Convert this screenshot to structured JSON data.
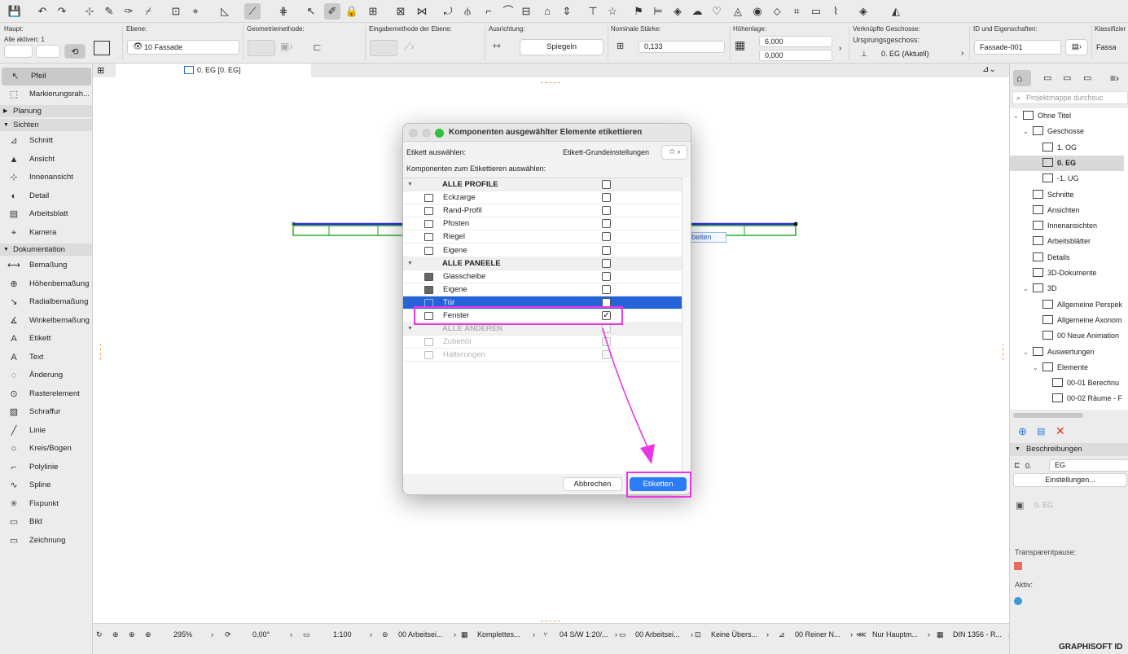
{
  "toolbar": {
    "icons": [
      "save-icon",
      "undo-icon",
      "redo-icon",
      "arrow-tool-icon",
      "magic-wand-icon",
      "eyedropper-icon",
      "syringe-icon",
      "select-icon",
      "guide-icon",
      "snap-icon",
      "trace-icon",
      "grid-icon",
      "pointer-icon",
      "pen-icon",
      "lock-icon",
      "group-icon",
      "suspend-icon",
      "mirror-icon",
      "rotate-icon",
      "split-icon",
      "offset-icon",
      "fillet-icon",
      "stretch-icon",
      "roof-icon",
      "elevate-icon",
      "dimension-icon",
      "star-icon",
      "flag-icon",
      "label-icon",
      "layer-icon",
      "cloud-icon",
      "favorite-icon",
      "tag-icon",
      "render-icon",
      "color-icon"
    ]
  },
  "infobox": {
    "haupt_label": "Haupt:",
    "alle_aktiven": "Alle aktiven: 1",
    "ebene_label": "Ebene:",
    "ebene_value": "10 Fassade",
    "geometrie_label": "Geometriemethode:",
    "eingabe_label": "Eingabemethode der Ebene:",
    "ausrichtung_label": "Ausrichtung:",
    "ausrichtung_value": "Spiegeln",
    "staerke_label": "Nominale Stärke:",
    "staerke_value": "0,133",
    "hoehe_label": "Höhenlage:",
    "hoehe_top": "6,000",
    "hoehe_bottom": "0,000",
    "geschosse_label": "Verknüpfte Geschosse:",
    "ursprung_label": "Ursprungsgeschoss:",
    "ursprung_value": "0. EG (Aktuell)",
    "id_label": "ID und Eigenschaften:",
    "id_value": "Fassade-001",
    "klass_label": "Klassifizier",
    "klass_value": "Fassa"
  },
  "toolbox": {
    "pfeil": "Pfeil",
    "markierung": "Markierungsrah...",
    "planung": "Planung",
    "sichten": "Sichten",
    "sichten_items": [
      "Schnitt",
      "Ansicht",
      "Innenansicht",
      "Detail",
      "Arbeitsblatt",
      "Kamera"
    ],
    "dokumentation": "Dokumentation",
    "doku_items": [
      "Bemaßung",
      "Höhenbemaßung",
      "Radialbemaßung",
      "Winkelbemaßung",
      "Etikett",
      "Text",
      "Änderung",
      "Rasterelement",
      "Schraffur",
      "Linie",
      "Kreis/Bogen",
      "Polylinie",
      "Spline",
      "Fixpunkt",
      "Bild",
      "Zeichnung"
    ]
  },
  "tab": {
    "label": "0. EG [0. EG]"
  },
  "canvas": {
    "tooltip_text": "beiten"
  },
  "dialog": {
    "title": "Komponenten ausgewählter Elemente etikettieren",
    "select_label": "Etikett auswählen:",
    "select_value": "Etikett-Grundeinstellungen",
    "components_label": "Komponenten zum Etikettieren auswählen:",
    "rows": [
      {
        "label": "ALLE PROFILE",
        "group": true,
        "checked": false,
        "disabled": false
      },
      {
        "label": "Eckzarge",
        "checked": false,
        "disabled": false
      },
      {
        "label": "Rand-Profil",
        "checked": false,
        "disabled": false
      },
      {
        "label": "Pfosten",
        "checked": false,
        "disabled": false
      },
      {
        "label": "Riegel",
        "checked": false,
        "disabled": false
      },
      {
        "label": "Eigene",
        "checked": false,
        "disabled": false
      },
      {
        "label": "ALLE PANEELE",
        "group": true,
        "checked": false,
        "disabled": false
      },
      {
        "label": "Glasscheibe",
        "checked": false,
        "disabled": false
      },
      {
        "label": "Eigene",
        "checked": false,
        "disabled": false
      },
      {
        "label": "Tür",
        "checked": false,
        "disabled": false,
        "selected": true
      },
      {
        "label": "Fenster",
        "checked": true,
        "disabled": false
      },
      {
        "label": "ALLE ANDEREN",
        "group": true,
        "checked": false,
        "disabled": true
      },
      {
        "label": "Zubehör",
        "checked": false,
        "disabled": true
      },
      {
        "label": "Halterungen",
        "checked": false,
        "disabled": true
      }
    ],
    "cancel": "Abbrechen",
    "ok": "Etiketten"
  },
  "statusbar": {
    "zoom": "295%",
    "angle": "0,00°",
    "scale": "1:100",
    "items": [
      "00 Arbeitsei...",
      "Komplettes...",
      "04 S/W 1:20/...",
      "00 Arbeitsei...",
      "Keine Übers...",
      "00 Reiner N...",
      "Nur Hauptm...",
      "DIN 1356 - R..."
    ]
  },
  "navigator": {
    "search_placeholder": "Projektmappe durchsuc",
    "tree": [
      "Ohne Titel",
      "Geschosse",
      "1. OG",
      "0. EG",
      "-1. UG",
      "Schnitte",
      "Ansichten",
      "Innenansichten",
      "Arbeitsblätter",
      "Details",
      "3D-Dokumente",
      "3D",
      "Allgemeine Perspek",
      "Allgemeine Axonom",
      "00 Neue Animation",
      "Auswertungen",
      "Elemente",
      "00-01 Berechnu",
      "00-02 Räume - F"
    ],
    "beschreibungen": "Beschreibungen",
    "desc_num": "0.",
    "desc_value": "EG",
    "einstellungen": "Einstellungen...",
    "geschoss_field": "0. EG",
    "transparent": "Transparentpause:",
    "aktiv": "Aktiv:",
    "brand": "GRAPHISOFT ID"
  },
  "colors": {
    "selection": "#2563d9",
    "annotation": "#ea37e6",
    "blue_line": "#2b2bdc",
    "green_line": "#1aa51a",
    "ok_button": "#2b7cf5"
  }
}
